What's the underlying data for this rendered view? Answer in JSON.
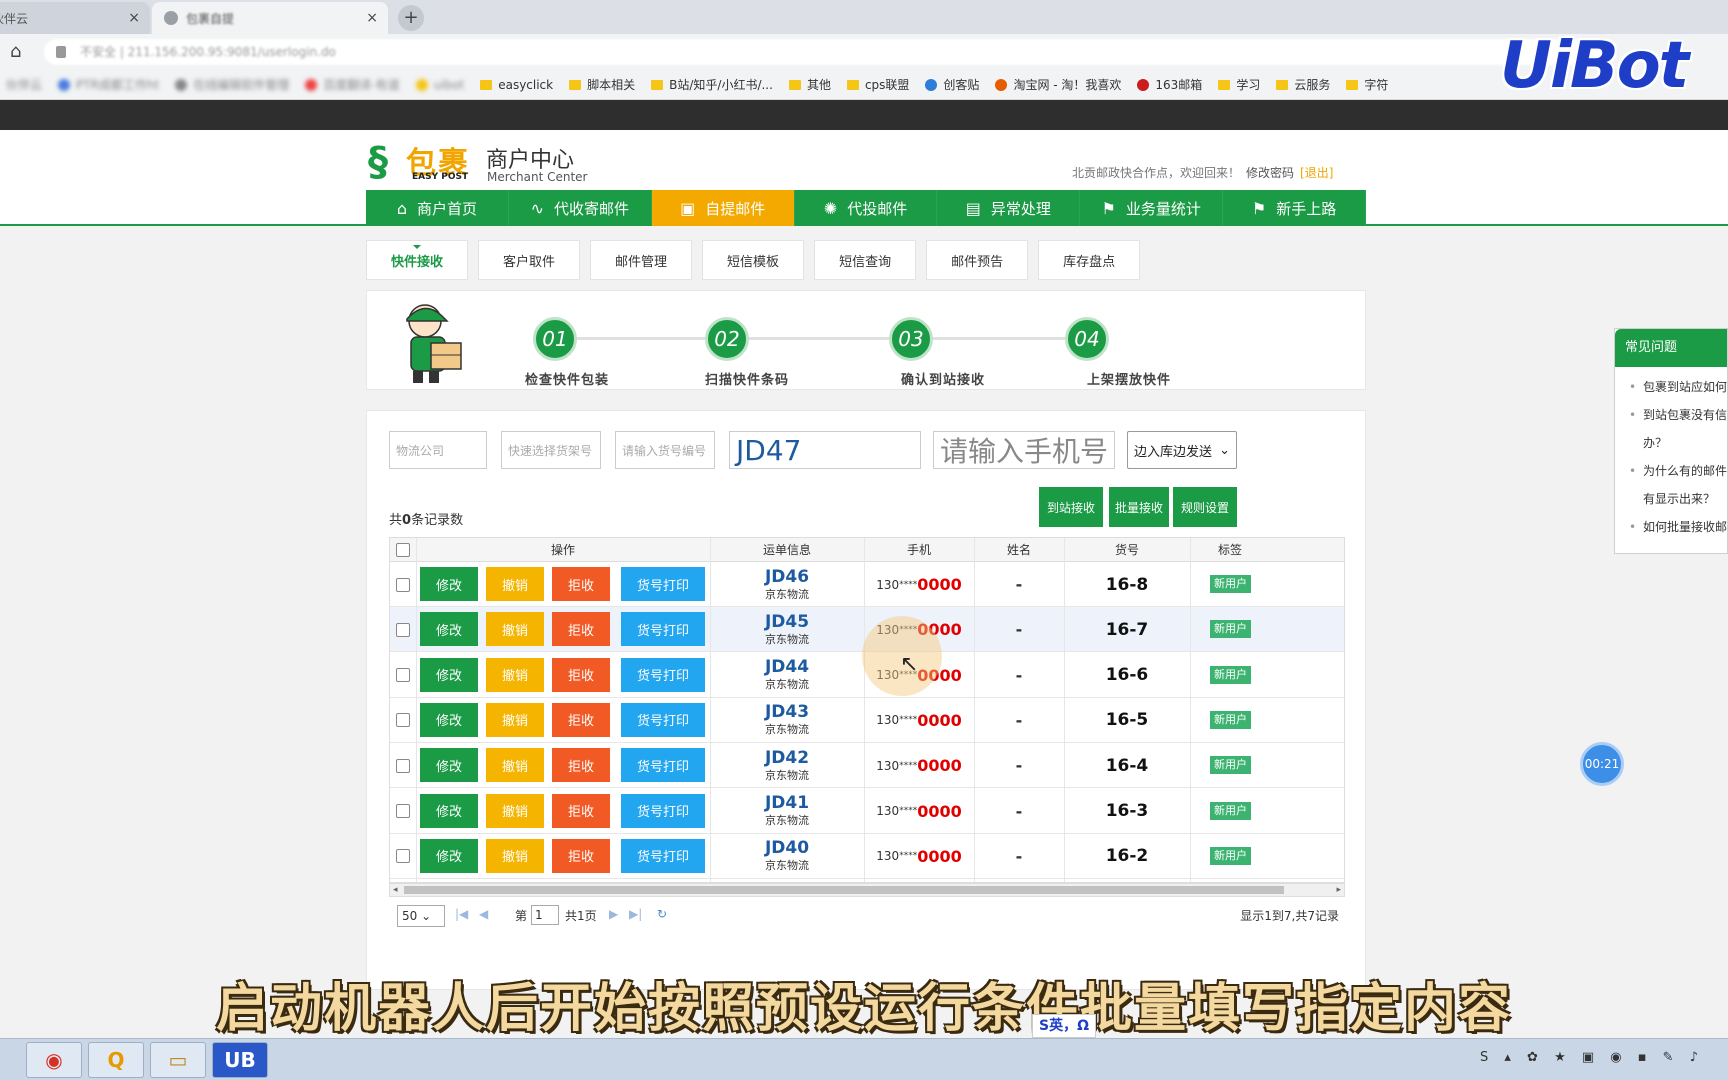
{
  "browser": {
    "tabs": [
      {
        "label": "伙伴云",
        "active": false
      },
      {
        "label": "包裹自提",
        "active": true
      }
    ],
    "new_tab": "+",
    "url": "不安全 | 211.156.200.95:9081/userlogin.do",
    "bookmarks": [
      {
        "label": "伙伴云",
        "blurred": true
      },
      {
        "label": "PTR成都工作ht",
        "blurred": true
      },
      {
        "label": "在线编辑软件管理",
        "blurred": true
      },
      {
        "label": "百度翻译-有道",
        "blurred": true
      },
      {
        "label": "uibot",
        "blurred": true
      },
      {
        "label": "easyclick",
        "blurred": false
      },
      {
        "label": "脚本相关",
        "blurred": false
      },
      {
        "label": "B站/知乎/小红书/...",
        "blurred": false
      },
      {
        "label": "其他",
        "blurred": false
      },
      {
        "label": "cps联盟",
        "blurred": false
      },
      {
        "label": "创客贴",
        "blurred": false
      },
      {
        "label": "淘宝网 - 淘！我喜欢",
        "blurred": false
      },
      {
        "label": "163邮箱",
        "blurred": false
      },
      {
        "label": "学习",
        "blurred": false
      },
      {
        "label": "云服务",
        "blurred": false
      },
      {
        "label": "字符",
        "blurred": false
      }
    ]
  },
  "overlay_logo": "UiBot",
  "header": {
    "brand": "包裹",
    "brand_en": "EASY POST",
    "title": "商户中心",
    "subtitle": "Merchant Center",
    "welcome": "北贡邮政快合作点，欢迎回来！",
    "change_pw": "修改密码",
    "logout": "[退出]"
  },
  "mainnav": [
    {
      "label": "商户首页",
      "icon": "⌂",
      "active": false
    },
    {
      "label": "代收寄邮件",
      "icon": "∿",
      "active": false
    },
    {
      "label": "自提邮件",
      "icon": "▣",
      "active": true
    },
    {
      "label": "代投邮件",
      "icon": "✺",
      "active": false
    },
    {
      "label": "异常处理",
      "icon": "▤",
      "active": false
    },
    {
      "label": "业务量统计",
      "icon": "⚑",
      "active": false
    },
    {
      "label": "新手上路",
      "icon": "⚑",
      "active": false
    }
  ],
  "subtabs": [
    "快件接收",
    "客户取件",
    "邮件管理",
    "短信模板",
    "短信查询",
    "邮件预告",
    "库存盘点"
  ],
  "steps": [
    {
      "num": "01",
      "label": "检查快件包装"
    },
    {
      "num": "02",
      "label": "扫描快件条码"
    },
    {
      "num": "03",
      "label": "确认到站接收"
    },
    {
      "num": "04",
      "label": "上架摆放快件"
    }
  ],
  "form": {
    "company_placeholder": "物流公司",
    "shelf_placeholder": "快速选择货架号",
    "slot_placeholder": "请输入货号编号",
    "waybill_value": "JD47",
    "phone_placeholder": "请输入手机号",
    "mode_select": "边入库边发送"
  },
  "record_count": {
    "prefix": "共",
    "count": "0",
    "suffix": "条记录数"
  },
  "action_buttons": [
    "到站接收",
    "批量接收",
    "规则设置"
  ],
  "table": {
    "headers": [
      "操作",
      "运单信息",
      "手机",
      "姓名",
      "货号",
      "标签"
    ],
    "row_buttons": [
      "修改",
      "撤销",
      "拒收",
      "货号打印"
    ],
    "rows": [
      {
        "waybill": "JD46",
        "company": "京东物流",
        "phone_prefix": "130",
        "phone_mask": "****",
        "phone_tail": "0000",
        "name": "-",
        "slot": "16-8",
        "tag": "新用户"
      },
      {
        "waybill": "JD45",
        "company": "京东物流",
        "phone_prefix": "130",
        "phone_mask": "****",
        "phone_tail": "0000",
        "name": "-",
        "slot": "16-7",
        "tag": "新用户"
      },
      {
        "waybill": "JD44",
        "company": "京东物流",
        "phone_prefix": "130",
        "phone_mask": "****",
        "phone_tail": "0000",
        "name": "-",
        "slot": "16-6",
        "tag": "新用户"
      },
      {
        "waybill": "JD43",
        "company": "京东物流",
        "phone_prefix": "130",
        "phone_mask": "****",
        "phone_tail": "0000",
        "name": "-",
        "slot": "16-5",
        "tag": "新用户"
      },
      {
        "waybill": "JD42",
        "company": "京东物流",
        "phone_prefix": "130",
        "phone_mask": "****",
        "phone_tail": "0000",
        "name": "-",
        "slot": "16-4",
        "tag": "新用户"
      },
      {
        "waybill": "JD41",
        "company": "京东物流",
        "phone_prefix": "130",
        "phone_mask": "****",
        "phone_tail": "0000",
        "name": "-",
        "slot": "16-3",
        "tag": "新用户"
      },
      {
        "waybill": "JD40",
        "company": "京东物流",
        "phone_prefix": "130",
        "phone_mask": "****",
        "phone_tail": "0000",
        "name": "-",
        "slot": "16-2",
        "tag": "新用户"
      }
    ]
  },
  "pager": {
    "page_size": "50",
    "page_label": "第",
    "page": "1",
    "total_pages": "共1页",
    "info": "显示1到7,共7记录"
  },
  "faq": {
    "title": "常见问题",
    "items": [
      "包裹到站应如何",
      "到站包裹没有信",
      "办？",
      "为什么有的邮件",
      "有显示出来？",
      "如何批量接收邮"
    ]
  },
  "timer": "00:21",
  "caption": "启动机器人后开始按照预设运行条件批量填写指定内容",
  "ime": "S英，Ω",
  "colors": {
    "brand_green": "#1c9b46",
    "active_orange": "#f4a900",
    "reject_red": "#f15a24",
    "print_blue": "#23a6f0",
    "undo_yellow": "#f4b400",
    "phone_red": "#e00000"
  }
}
